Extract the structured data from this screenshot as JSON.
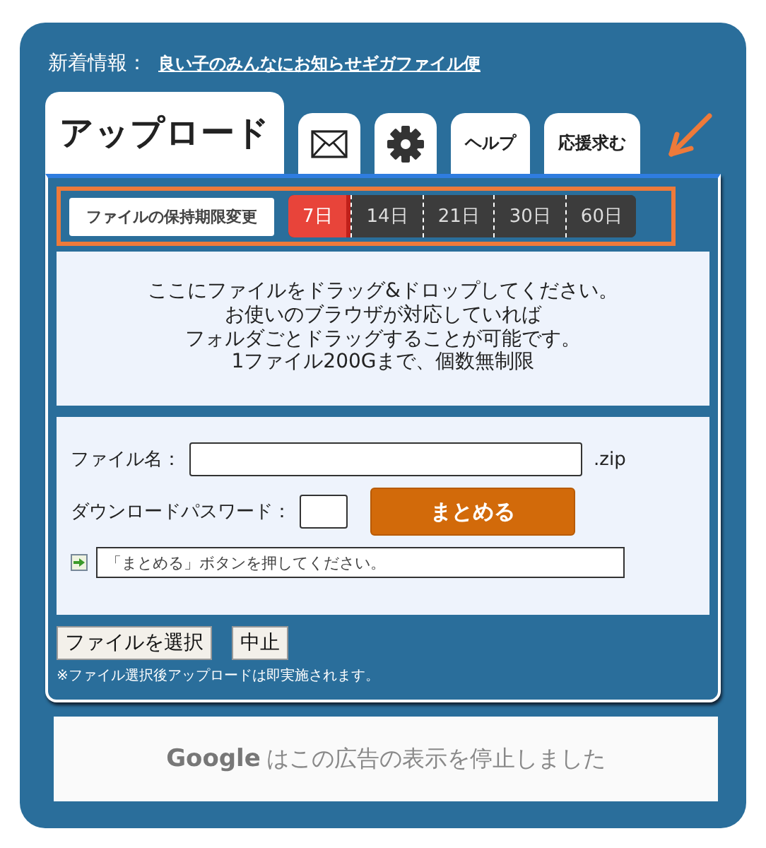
{
  "news": {
    "label": "新着情報：",
    "link": "良い子のみんなにお知らせギガファイル便"
  },
  "tabs": [
    {
      "kind": "text",
      "label": "アップロード",
      "selected": true
    },
    {
      "kind": "mail",
      "selected": false
    },
    {
      "kind": "gear",
      "selected": false
    },
    {
      "kind": "text",
      "label": "ヘルプ",
      "selected": false
    },
    {
      "kind": "text",
      "label": "応援求む",
      "selected": false
    }
  ],
  "retention": {
    "label": "ファイルの保持期限変更",
    "options": [
      {
        "label": "7日",
        "selected": true
      },
      {
        "label": "14日",
        "selected": false
      },
      {
        "label": "21日",
        "selected": false
      },
      {
        "label": "30日",
        "selected": false
      },
      {
        "label": "60日",
        "selected": false
      }
    ]
  },
  "drop_zone": {
    "lines": [
      "ここにファイルをドラッグ&ドロップしてください。",
      "お使いのブラウザが対応していれば",
      "フォルダごとドラッグすることが可能です。",
      "1ファイル200Gまで、個数無制限"
    ]
  },
  "form": {
    "filename_label": "ファイル名：",
    "filename_suffix": ".zip",
    "password_label": "ダウンロードパスワード：",
    "submit": "まとめる",
    "status": "「まとめる」ボタンを押してください。"
  },
  "buttons": [
    "ファイルを選択",
    "中止"
  ],
  "note": "※ファイル選択後アップロードは即実施されます。",
  "ad": {
    "brand": "Google",
    "message": "はこの広告の表示を停止しました"
  }
}
